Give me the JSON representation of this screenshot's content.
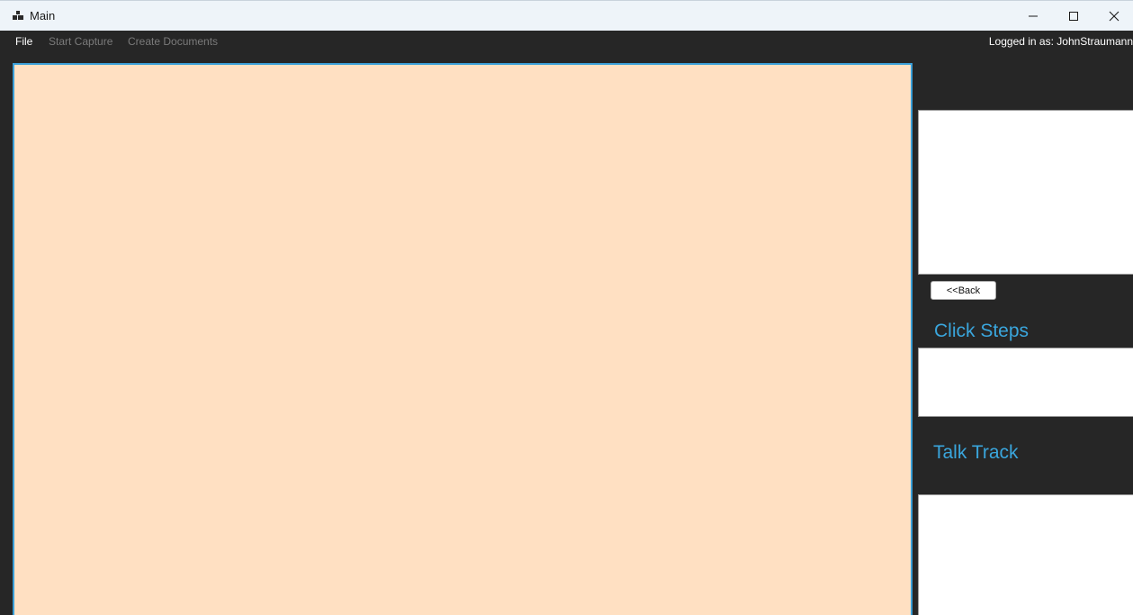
{
  "window": {
    "title": "Main",
    "icon": "app-icon",
    "controls": {
      "minimize_icon": "minimize-icon",
      "maximize_icon": "maximize-icon",
      "close_icon": "close-icon"
    }
  },
  "menu": {
    "items": [
      {
        "label": "File",
        "enabled": true
      },
      {
        "label": "Start Capture",
        "enabled": false
      },
      {
        "label": "Create Documents",
        "enabled": false
      }
    ],
    "logged_in": "Logged in as: JohnStraumann"
  },
  "canvas": {
    "background": "#ffe0c2",
    "border_color": "#3a9fd8"
  },
  "right_panel": {
    "back_button": "<<Back",
    "click_steps_title": "Click Steps",
    "talk_track_title": "Talk Track",
    "heading_color": "#3aa6dd"
  }
}
